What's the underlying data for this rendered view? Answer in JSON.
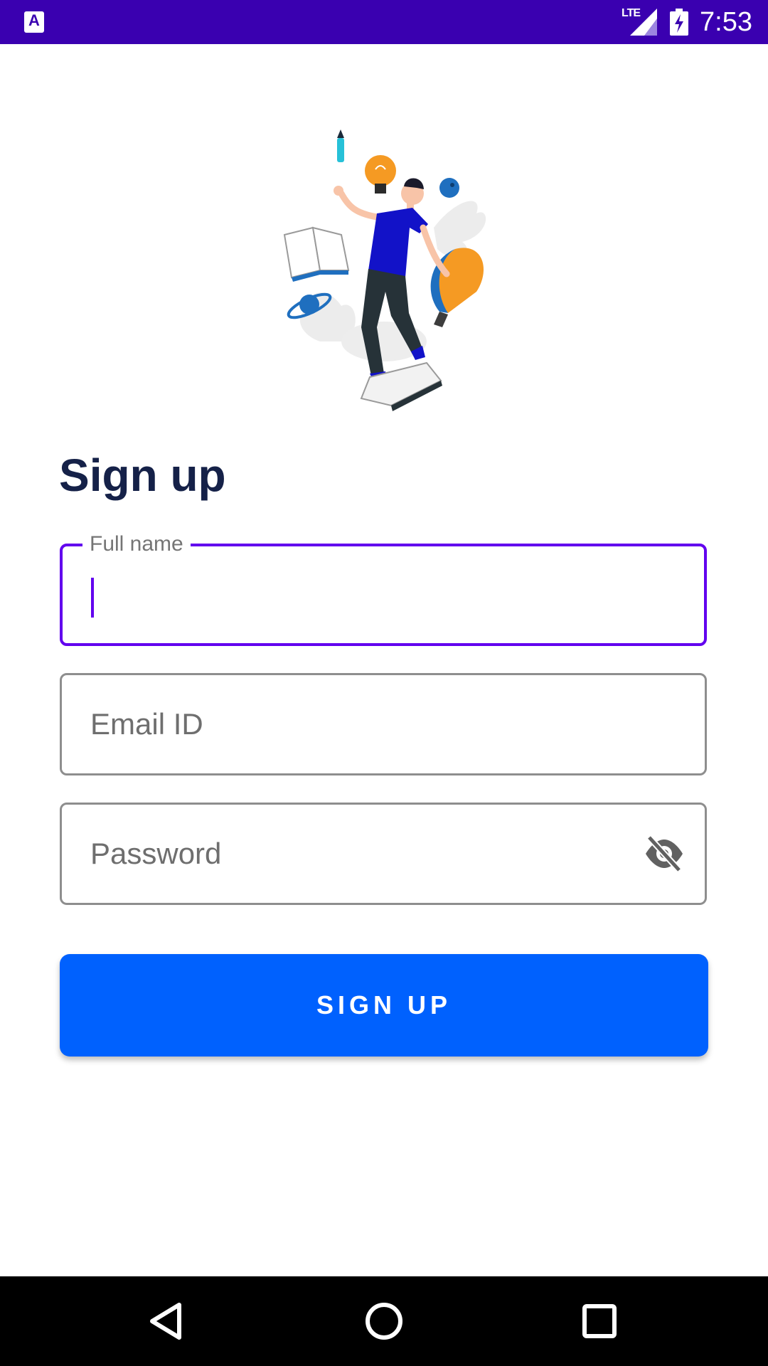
{
  "status_bar": {
    "app_icon": "A",
    "network": "LTE",
    "time": "7:53",
    "icons": [
      "app-notification-icon",
      "signal-icon",
      "battery-charging-icon"
    ]
  },
  "illustration": {
    "icon": "person-juggling-ideas-illustration"
  },
  "page": {
    "title": "Sign up"
  },
  "form": {
    "full_name": {
      "label": "Full name",
      "value": "",
      "focused": true
    },
    "email": {
      "placeholder": "Email ID",
      "value": ""
    },
    "password": {
      "placeholder": "Password",
      "value": "",
      "toggle_icon": "eye-off-icon"
    },
    "submit_label": "SIGN UP"
  },
  "nav_bar": {
    "icons": [
      "back-icon",
      "home-icon",
      "recents-icon"
    ]
  },
  "colors": {
    "status_bar": "#3a00b0",
    "focus": "#6200ee",
    "button": "#0061fe",
    "title": "#152148"
  }
}
